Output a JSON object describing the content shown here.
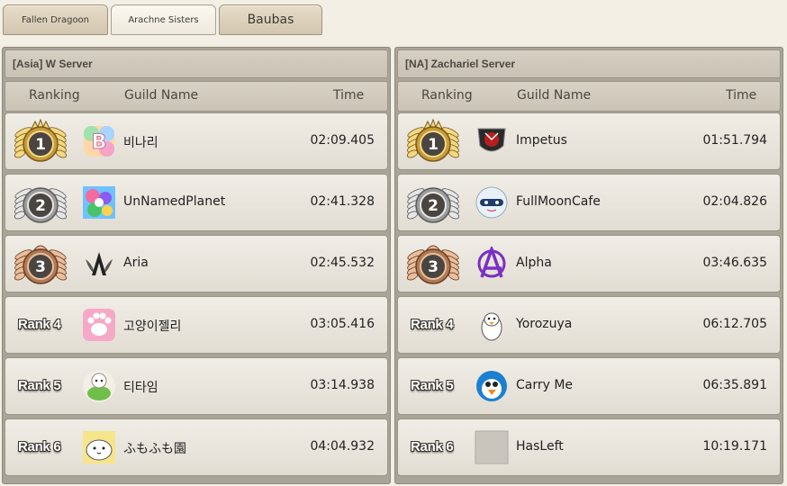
{
  "tabs": [
    "Fallen Dragoon",
    "Arachne Sisters",
    "Baubas"
  ],
  "columns": {
    "ranking": "Ranking",
    "guild": "Guild Name",
    "time": "Time"
  },
  "panels": [
    {
      "title": "[Asia] W Server",
      "rows": [
        {
          "rank": "1",
          "medal": "gold",
          "guild": "비나리",
          "time": "02:09.405",
          "emblem": "rainbow-b-emblem-icon"
        },
        {
          "rank": "2",
          "medal": "silver",
          "guild": "UnNamedPlanet",
          "time": "02:41.328",
          "emblem": "colorful-planet-emblem-icon"
        },
        {
          "rank": "3",
          "medal": "bronze",
          "guild": "Aria",
          "time": "02:45.532",
          "emblem": "winged-a-emblem-icon"
        },
        {
          "rank": "Rank 4",
          "medal": "none",
          "guild": "고양이젤리",
          "time": "03:05.416",
          "emblem": "cat-paw-emblem-icon"
        },
        {
          "rank": "Rank 5",
          "medal": "none",
          "guild": "티타임",
          "time": "03:14.938",
          "emblem": "sheep-teacup-emblem-icon"
        },
        {
          "rank": "Rank 6",
          "medal": "none",
          "guild": "ふもふも園",
          "time": "04:04.932",
          "emblem": "white-creature-emblem-icon"
        }
      ]
    },
    {
      "title": "[NA] Zachariel Server",
      "rows": [
        {
          "rank": "1",
          "medal": "gold",
          "guild": "Impetus",
          "time": "01:51.794",
          "emblem": "red-dragon-shield-emblem-icon"
        },
        {
          "rank": "2",
          "medal": "silver",
          "guild": "FullMoonCafe",
          "time": "02:04.826",
          "emblem": "moon-face-emblem-icon"
        },
        {
          "rank": "3",
          "medal": "bronze",
          "guild": "Alpha",
          "time": "03:46.635",
          "emblem": "purple-anarchy-emblem-icon"
        },
        {
          "rank": "Rank 4",
          "medal": "none",
          "guild": "Yorozuya",
          "time": "06:12.705",
          "emblem": "penguin-emblem-icon"
        },
        {
          "rank": "Rank 5",
          "medal": "none",
          "guild": "Carry Me",
          "time": "06:35.891",
          "emblem": "blue-bird-emblem-icon"
        },
        {
          "rank": "Rank 6",
          "medal": "none",
          "guild": "HasLeft",
          "time": "10:19.171",
          "emblem": "grey-placeholder-emblem-icon"
        }
      ]
    }
  ]
}
